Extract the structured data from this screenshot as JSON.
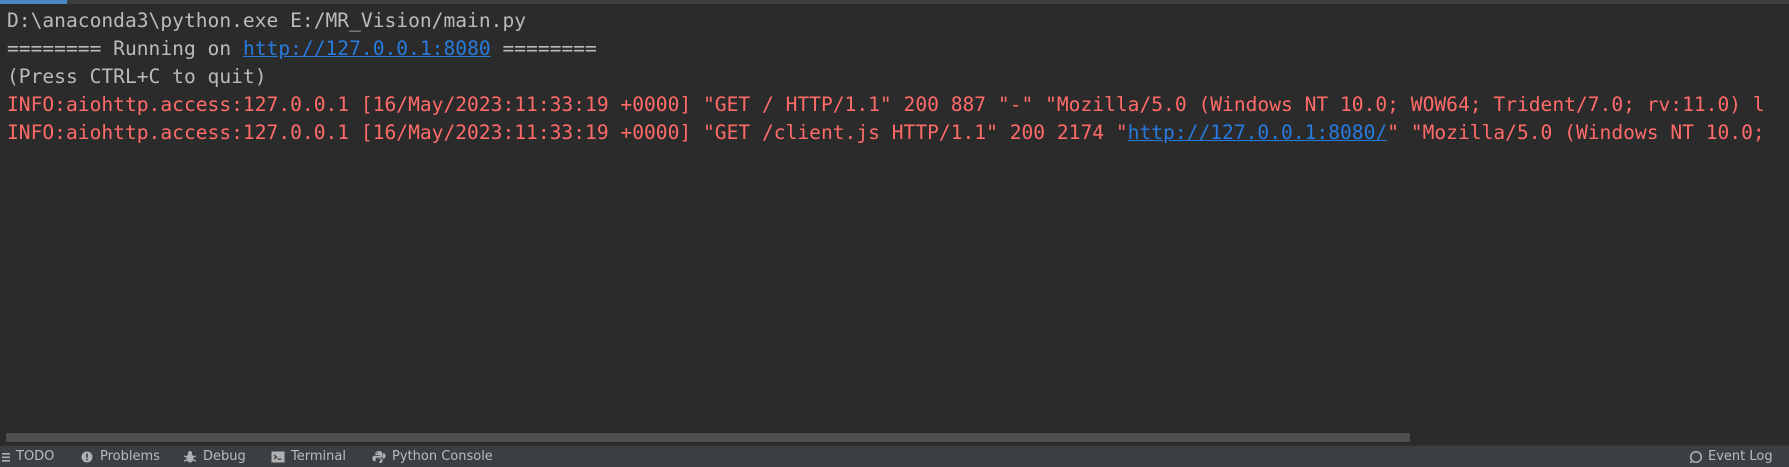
{
  "console": {
    "lines": [
      {
        "kind": "normal",
        "text": "D:\\anaconda3\\python.exe E:/MR_Vision/main.py"
      },
      {
        "kind": "normal",
        "prefix": "======== Running on ",
        "link": "http://127.0.0.1:8080",
        "suffix": " ========"
      },
      {
        "kind": "normal",
        "text": "(Press CTRL+C to quit)"
      },
      {
        "kind": "error",
        "text": "INFO:aiohttp.access:127.0.0.1 [16/May/2023:11:33:19 +0000] \"GET / HTTP/1.1\" 200 887 \"-\" \"Mozilla/5.0 (Windows NT 10.0; WOW64; Trident/7.0; rv:11.0) l"
      },
      {
        "kind": "error",
        "prefix": "INFO:aiohttp.access:127.0.0.1 [16/May/2023:11:33:19 +0000] \"GET /client.js HTTP/1.1\" 200 2174 \"",
        "link": "http://127.0.0.1:8080/",
        "suffix": "\" \"Mozilla/5.0 (Windows NT 10.0;"
      }
    ]
  },
  "toolbar": {
    "items": [
      {
        "label": "TODO",
        "icon": "list-icon"
      },
      {
        "label": "Problems",
        "icon": "warning-circle-icon"
      },
      {
        "label": "Debug",
        "icon": "bug-icon"
      },
      {
        "label": "Terminal",
        "icon": "terminal-icon"
      },
      {
        "label": "Python Console",
        "icon": "python-icon"
      }
    ],
    "event_log": {
      "label": "Event Log",
      "icon": "search-icon"
    }
  },
  "colors": {
    "background": "#2b2b2b",
    "normal_text": "#bbbbbb",
    "error_text": "#ff6b68",
    "link": "#287bde",
    "toolbar": "#3c3f41"
  }
}
